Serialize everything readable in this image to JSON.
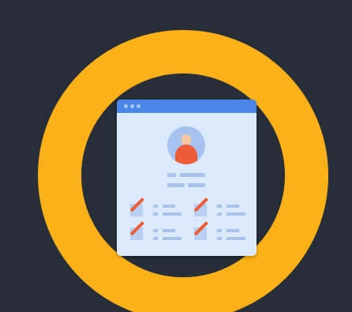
{
  "illustration": {
    "subject": "resume-checklist-icon",
    "colors": {
      "background": "#272e38",
      "ring": "#fbb117",
      "window_body": "#dce8fb",
      "title_bar": "#4a86e8",
      "accent": "#ed5c38",
      "lines": "#a9c4ec"
    },
    "checklist_items": 4,
    "checked_items": 4
  }
}
